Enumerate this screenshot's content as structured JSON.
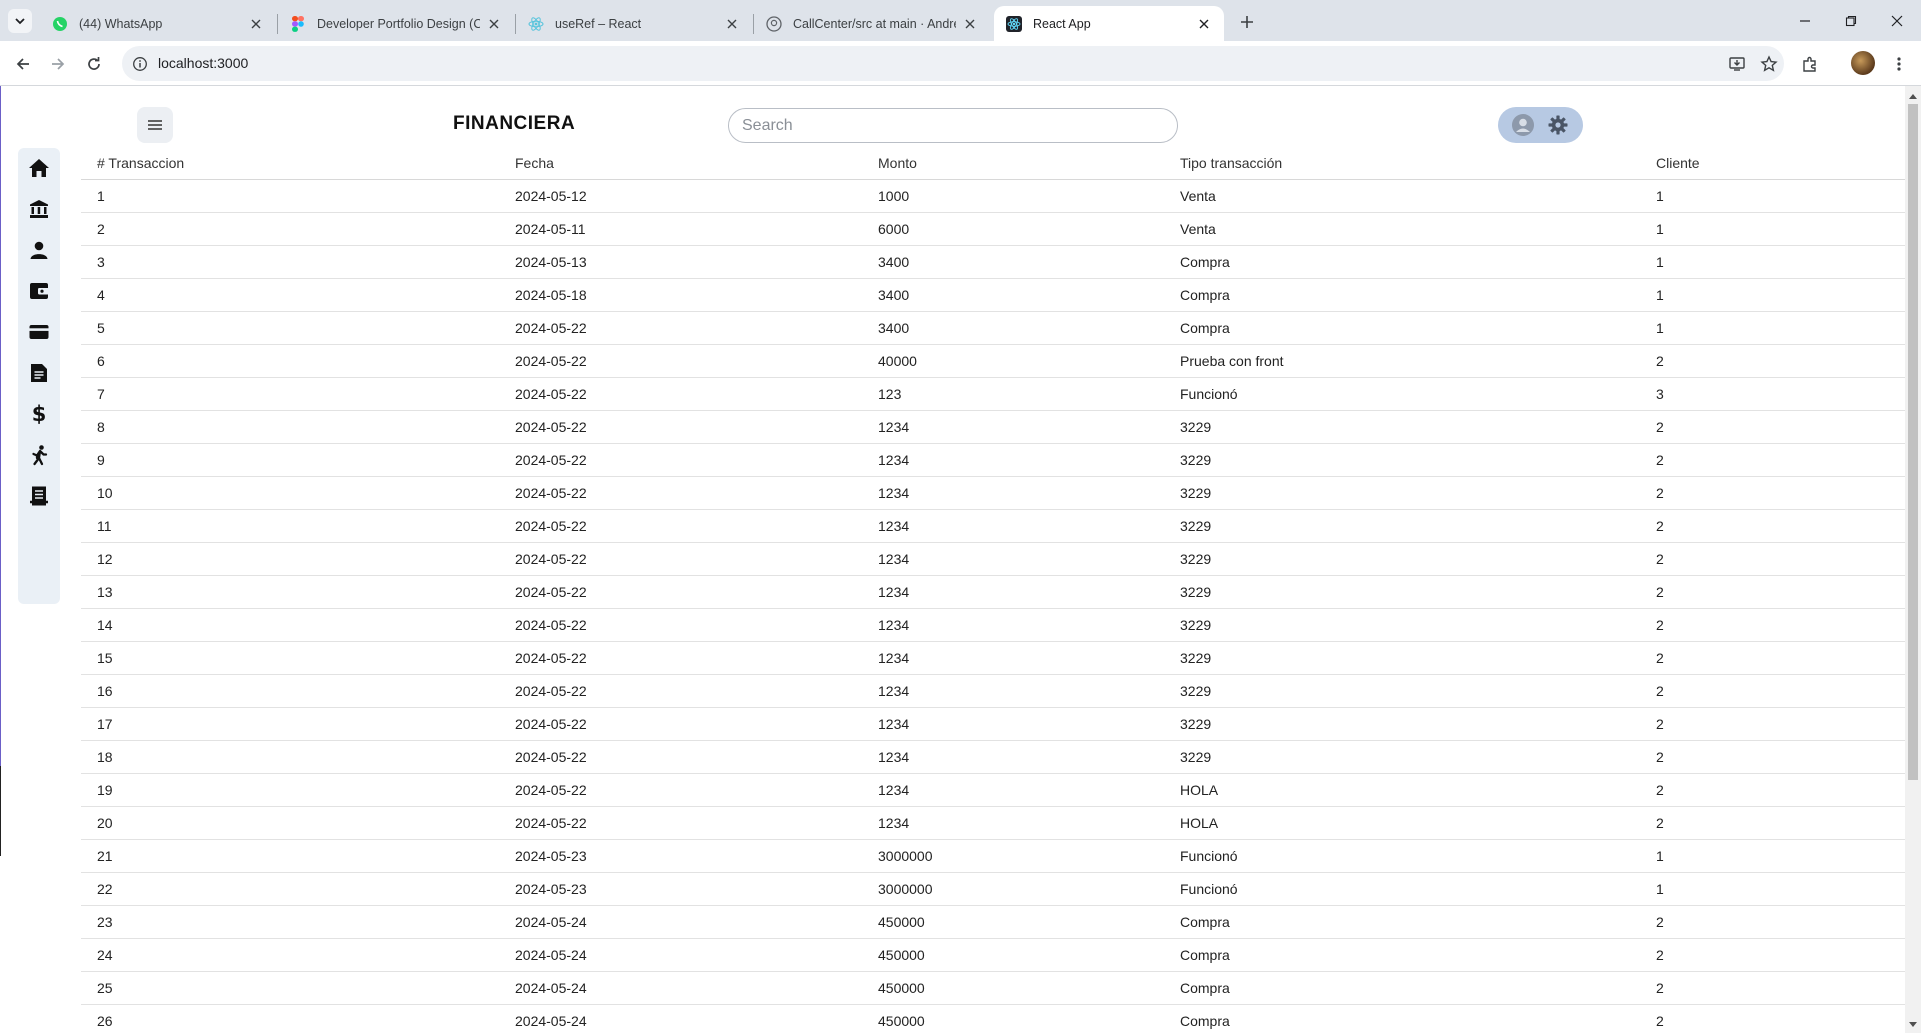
{
  "browser": {
    "tabs": [
      {
        "title": "(44) WhatsApp",
        "icon": "whatsapp-icon",
        "active": false
      },
      {
        "title": "Developer Portfolio Design (Co",
        "icon": "figma-icon",
        "active": false
      },
      {
        "title": "useRef – React",
        "icon": "react-icon",
        "active": false
      },
      {
        "title": "CallCenter/src at main · Andres",
        "icon": "github-icon",
        "active": false
      },
      {
        "title": "React App",
        "icon": "react-icon",
        "active": true
      }
    ],
    "url": "localhost:3000"
  },
  "app": {
    "brand": "FINANCIERA",
    "search_placeholder": "Search",
    "sidebar": [
      {
        "icon": "home-icon"
      },
      {
        "icon": "bank-icon"
      },
      {
        "icon": "person-icon"
      },
      {
        "icon": "wallet-icon"
      },
      {
        "icon": "credit-card-icon"
      },
      {
        "icon": "document-icon"
      },
      {
        "icon": "dollar-icon"
      },
      {
        "icon": "person-walking-icon"
      },
      {
        "icon": "receipt-icon"
      }
    ]
  },
  "table": {
    "headers": [
      "# Transaccion",
      "Fecha",
      "Monto",
      "Tipo transacción",
      "Cliente"
    ],
    "rows": [
      [
        "1",
        "2024-05-12",
        "1000",
        "Venta",
        "1"
      ],
      [
        "2",
        "2024-05-11",
        "6000",
        "Venta",
        "1"
      ],
      [
        "3",
        "2024-05-13",
        "3400",
        "Compra",
        "1"
      ],
      [
        "4",
        "2024-05-18",
        "3400",
        "Compra",
        "1"
      ],
      [
        "5",
        "2024-05-22",
        "3400",
        "Compra",
        "1"
      ],
      [
        "6",
        "2024-05-22",
        "40000",
        "Prueba con front",
        "2"
      ],
      [
        "7",
        "2024-05-22",
        "123",
        "Funcionó",
        "3"
      ],
      [
        "8",
        "2024-05-22",
        "1234",
        "3229",
        "2"
      ],
      [
        "9",
        "2024-05-22",
        "1234",
        "3229",
        "2"
      ],
      [
        "10",
        "2024-05-22",
        "1234",
        "3229",
        "2"
      ],
      [
        "11",
        "2024-05-22",
        "1234",
        "3229",
        "2"
      ],
      [
        "12",
        "2024-05-22",
        "1234",
        "3229",
        "2"
      ],
      [
        "13",
        "2024-05-22",
        "1234",
        "3229",
        "2"
      ],
      [
        "14",
        "2024-05-22",
        "1234",
        "3229",
        "2"
      ],
      [
        "15",
        "2024-05-22",
        "1234",
        "3229",
        "2"
      ],
      [
        "16",
        "2024-05-22",
        "1234",
        "3229",
        "2"
      ],
      [
        "17",
        "2024-05-22",
        "1234",
        "3229",
        "2"
      ],
      [
        "18",
        "2024-05-22",
        "1234",
        "3229",
        "2"
      ],
      [
        "19",
        "2024-05-22",
        "1234",
        "HOLA",
        "2"
      ],
      [
        "20",
        "2024-05-22",
        "1234",
        "HOLA",
        "2"
      ],
      [
        "21",
        "2024-05-23",
        "3000000",
        "Funcionó",
        "1"
      ],
      [
        "22",
        "2024-05-23",
        "3000000",
        "Funcionó",
        "1"
      ],
      [
        "23",
        "2024-05-24",
        "450000",
        "Compra",
        "2"
      ],
      [
        "24",
        "2024-05-24",
        "450000",
        "Compra",
        "2"
      ],
      [
        "25",
        "2024-05-24",
        "450000",
        "Compra",
        "2"
      ],
      [
        "26",
        "2024-05-24",
        "450000",
        "Compra",
        "2"
      ]
    ]
  },
  "colors": {
    "tabstrip": "#dee3ea",
    "omnibox": "#eef1f5",
    "sidebar": "#eaf0f6",
    "user_pill": "#b7c9e3"
  }
}
